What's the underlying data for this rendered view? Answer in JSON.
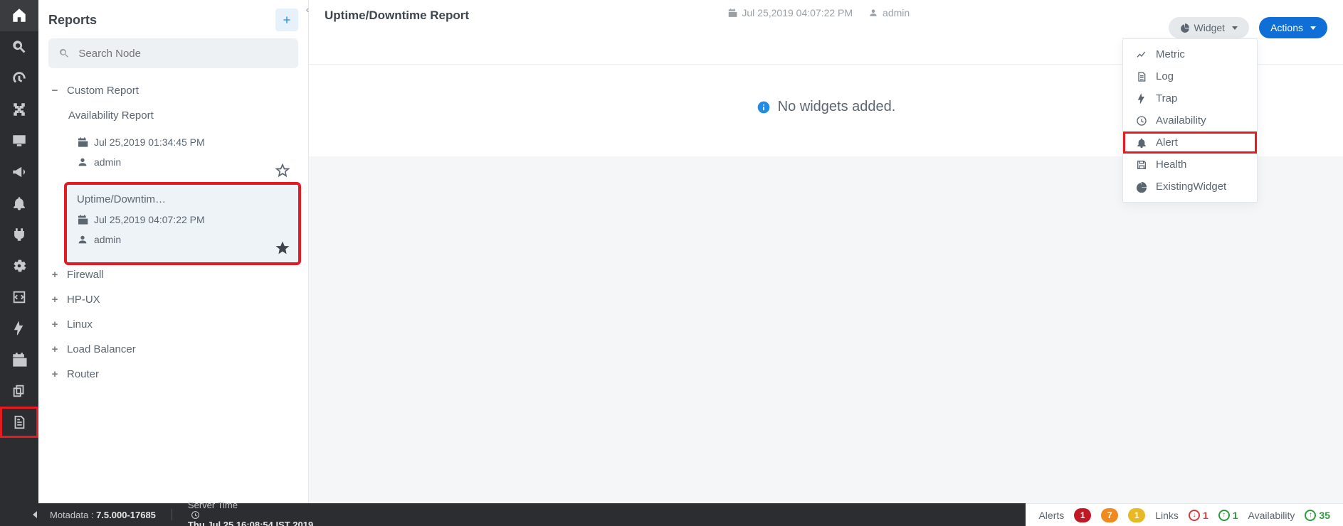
{
  "sidebar": {
    "title": "Reports",
    "search_placeholder": "Search Node",
    "root": {
      "label": "Custom Report"
    },
    "availability_label": "Availability Report",
    "nodes": [
      {
        "label": "Firewall"
      },
      {
        "label": "HP-UX"
      },
      {
        "label": "Linux"
      },
      {
        "label": "Load Balancer"
      },
      {
        "label": "Router"
      }
    ]
  },
  "reports": [
    {
      "title": "Jul 25,2019 01:34:45 PM",
      "date": "Jul 25,2019 01:34:45 PM",
      "user": "admin",
      "starred": false
    },
    {
      "title": "Uptime/Downtim…",
      "date": "Jul 25,2019 04:07:22 PM",
      "user": "admin",
      "starred": true
    }
  ],
  "header": {
    "title": "Uptime/Downtime Report",
    "date": "Jul 25,2019 04:07:22 PM",
    "user": "admin",
    "widget_btn": "Widget",
    "actions_btn": "Actions"
  },
  "empty_msg": "No widgets added.",
  "widget_menu": [
    {
      "label": "Metric"
    },
    {
      "label": "Log"
    },
    {
      "label": "Trap"
    },
    {
      "label": "Availability"
    },
    {
      "label": "Alert",
      "hl": true
    },
    {
      "label": "Health"
    },
    {
      "label": "ExistingWidget"
    }
  ],
  "status": {
    "brand": "Motadata :",
    "version": "7.5.000-17685",
    "server_label": "Server Time",
    "server_time": "Thu Jul 25 16:08:54 IST 2019",
    "alerts_label": "Alerts",
    "alerts": [
      "1",
      "7",
      "1"
    ],
    "links_label": "Links",
    "links_down": "1",
    "links_up": "1",
    "avail_label": "Availability",
    "avail_up": "35"
  }
}
